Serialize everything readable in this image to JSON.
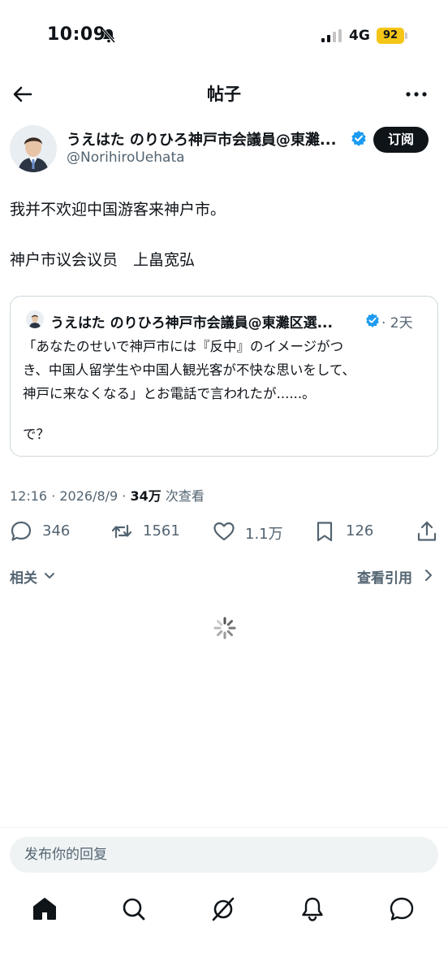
{
  "status_bar": {
    "time": "10:09",
    "network": "4G",
    "battery": "92"
  },
  "header": {
    "title": "帖子"
  },
  "author": {
    "name": "うえはた のりひろ神戸市会議員@東灘...",
    "handle": "@NorihiroUehata",
    "subscribe_label": "订阅"
  },
  "tweet": {
    "lines": [
      "我并不欢迎中国游客来神户市。",
      "神户市议会议员　上畠宽弘"
    ]
  },
  "quote": {
    "name": "うえはた のりひろ神戸市会議員@東灘区選...",
    "time": "· 2天",
    "lines": [
      "「あなたのせいで神戸市には『反中』のイメージがつ",
      "き、中国人留学生や中国人観光客が不快な思いをして、",
      "神戸に来なくなる」とお電話で言われたが......。",
      "で？"
    ]
  },
  "meta": {
    "timestamp": "12:16 · 2026/8/9 · ",
    "views": "34万",
    "views_label": " 次查看"
  },
  "actions": {
    "replies": "346",
    "reposts": "1561",
    "likes": "1.1万",
    "bookmarks": "126"
  },
  "related_label": "相关",
  "quotes_label": "查看引用",
  "reply_placeholder": "发布你的回复",
  "colors": {
    "accent": "#1d9bf0",
    "text": "#0f1419",
    "secondary": "#536471",
    "battery": "#f5c518"
  },
  "bottom_nav": [
    "home-icon",
    "search-icon",
    "grok-icon",
    "notifications-icon",
    "messages-icon"
  ]
}
